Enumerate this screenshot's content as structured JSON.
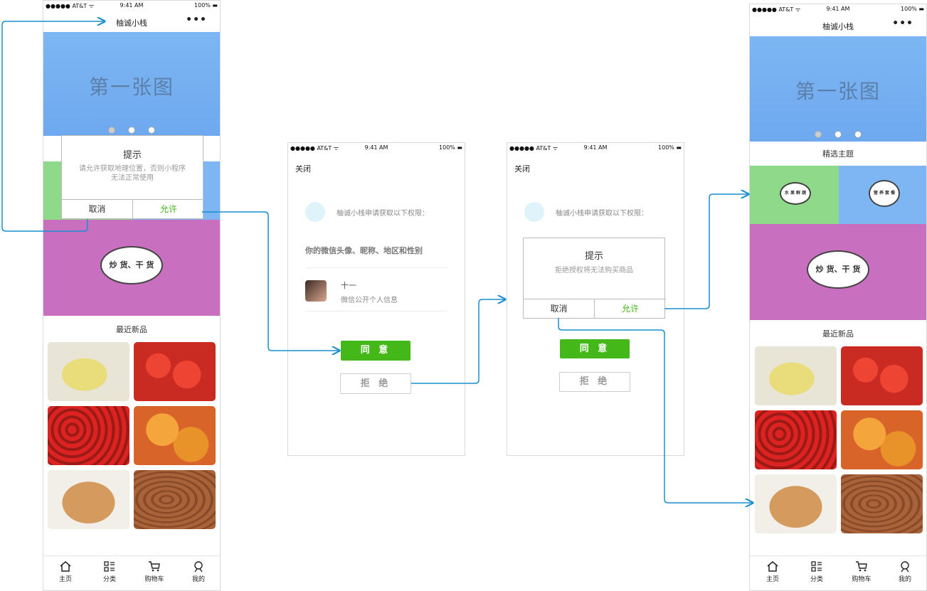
{
  "status": {
    "carrier": "●●●●● AT&T ᯤ",
    "time": "9:41 AM",
    "battery": "100% ▬"
  },
  "app_title": "柚诚小栈",
  "more_glyph": "•••",
  "banner_text": "第一张图",
  "featured_title": "精选主题",
  "bubble_main": "炒 货、干 货",
  "bubble_small_left": "水 果 鲜 蔬",
  "bubble_small_right": "营 养 套 餐",
  "new_products_title": "最近新品",
  "location_modal": {
    "title": "提示",
    "message": "请允许获取地理位置，否则小程序无法正常使用",
    "cancel": "取消",
    "allow": "允许"
  },
  "auth": {
    "close": "关闭",
    "request": "柚诚小栈申请获取以下权限：",
    "scope": "你的微信头像、昵称、地区和性别",
    "user_name": "十一",
    "user_desc": "微信公开个人信息",
    "agree": "同 意",
    "reject": "拒 绝"
  },
  "reject_modal": {
    "title": "提示",
    "message": "拒绝授权将无法购买商品",
    "cancel": "取消",
    "allow": "允许"
  },
  "tabs": [
    {
      "label": "主页",
      "icon": "home-icon"
    },
    {
      "label": "分类",
      "icon": "category-icon"
    },
    {
      "label": "购物车",
      "icon": "cart-icon"
    },
    {
      "label": "我的",
      "icon": "profile-icon"
    }
  ],
  "colors": {
    "accent_green": "#44b719",
    "banner_blue": "#7db6f3",
    "tile_green": "#8ed98a",
    "tile_purple": "#c86fc0",
    "flow_line": "#1a8fd0"
  }
}
